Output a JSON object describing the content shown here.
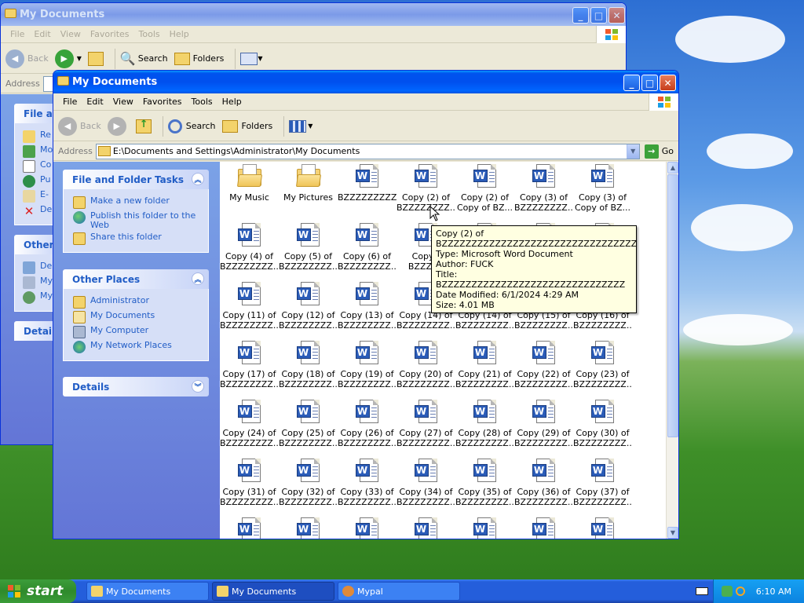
{
  "back_window": {
    "title": "My Documents",
    "menu": [
      "File",
      "Edit",
      "View",
      "Favorites",
      "Tools",
      "Help"
    ],
    "toolbar": {
      "back": "Back",
      "search": "Search",
      "folders": "Folders"
    },
    "address_label": "Address",
    "pane_headers": [
      "File an",
      "Other",
      "Details"
    ],
    "pane_items_a": [
      "Re",
      "Mo",
      "Co",
      "Pu",
      "E-",
      "De"
    ],
    "pane_items_b": [
      "De",
      "My",
      "My"
    ]
  },
  "front_window": {
    "title": "My Documents",
    "menu": [
      "File",
      "Edit",
      "View",
      "Favorites",
      "Tools",
      "Help"
    ],
    "toolbar": {
      "back": "Back",
      "search": "Search",
      "folders": "Folders"
    },
    "address": {
      "label": "Address",
      "value": "E:\\Documents and Settings\\Administrator\\My Documents",
      "go": "Go"
    },
    "tasks": {
      "title": "File and Folder Tasks",
      "items": [
        "Make a new folder",
        "Publish this folder to the Web",
        "Share this folder"
      ]
    },
    "other_places": {
      "title": "Other Places",
      "items": [
        "Administrator",
        "My Documents",
        "My Computer",
        "My Network Places"
      ]
    },
    "details": {
      "title": "Details"
    }
  },
  "files": [
    {
      "l1": "My Music",
      "l2": ""
    },
    {
      "l1": "My Pictures",
      "l2": ""
    },
    {
      "l1": "BZZZZZZZZZ...",
      "l2": ""
    },
    {
      "l1": "Copy (2) of",
      "l2": "BZZZZZZZZ..."
    },
    {
      "l1": "Copy (2) of",
      "l2": "Copy of BZ..."
    },
    {
      "l1": "Copy (3) of",
      "l2": "BZZZZZZZZ..."
    },
    {
      "l1": "Copy (3) of",
      "l2": "Copy of BZ..."
    },
    {
      "l1": "Copy (4) of",
      "l2": "BZZZZZZZZ..."
    },
    {
      "l1": "Copy (5) of",
      "l2": "BZZZZZZZZ..."
    },
    {
      "l1": "Copy (6) of",
      "l2": "BZZZZZZZZ..."
    },
    {
      "l1": "Copy (",
      "l2": "BZZZZZ"
    },
    {
      "l1": "",
      "l2": ""
    },
    {
      "l1": "",
      "l2": ""
    },
    {
      "l1": "",
      "l2": ""
    },
    {
      "l1": "Copy (11) of",
      "l2": "BZZZZZZZZ..."
    },
    {
      "l1": "Copy (12) of",
      "l2": "BZZZZZZZZ..."
    },
    {
      "l1": "Copy (13) of",
      "l2": "BZZZZZZZZ..."
    },
    {
      "l1": "Copy (14) of",
      "l2": "BZZZZZZZZ..."
    },
    {
      "l1": "Copy (14) of",
      "l2": "BZZZZZZZZ..."
    },
    {
      "l1": "Copy (15) of",
      "l2": "BZZZZZZZZ..."
    },
    {
      "l1": "Copy (16) of",
      "l2": "BZZZZZZZZ..."
    },
    {
      "l1": "Copy (17) of",
      "l2": "BZZZZZZZZ..."
    },
    {
      "l1": "Copy (18) of",
      "l2": "BZZZZZZZZ..."
    },
    {
      "l1": "Copy (19) of",
      "l2": "BZZZZZZZZ..."
    },
    {
      "l1": "Copy (20) of",
      "l2": "BZZZZZZZZ..."
    },
    {
      "l1": "Copy (21) of",
      "l2": "BZZZZZZZZ..."
    },
    {
      "l1": "Copy (22) of",
      "l2": "BZZZZZZZZ..."
    },
    {
      "l1": "Copy (23) of",
      "l2": "BZZZZZZZZ..."
    },
    {
      "l1": "Copy (24) of",
      "l2": "BZZZZZZZZ..."
    },
    {
      "l1": "Copy (25) of",
      "l2": "BZZZZZZZZ..."
    },
    {
      "l1": "Copy (26) of",
      "l2": "BZZZZZZZZ..."
    },
    {
      "l1": "Copy (27) of",
      "l2": "BZZZZZZZZ..."
    },
    {
      "l1": "Copy (28) of",
      "l2": "BZZZZZZZZ..."
    },
    {
      "l1": "Copy (29) of",
      "l2": "BZZZZZZZZ..."
    },
    {
      "l1": "Copy (30) of",
      "l2": "BZZZZZZZZ..."
    },
    {
      "l1": "Copy (31) of",
      "l2": "BZZZZZZZZ..."
    },
    {
      "l1": "Copy (32) of",
      "l2": "BZZZZZZZZ..."
    },
    {
      "l1": "Copy (33) of",
      "l2": "BZZZZZZZZ..."
    },
    {
      "l1": "Copy (34) of",
      "l2": "BZZZZZZZZ..."
    },
    {
      "l1": "Copy (35) of",
      "l2": "BZZZZZZZZ..."
    },
    {
      "l1": "Copy (36) of",
      "l2": "BZZZZZZZZ..."
    },
    {
      "l1": "Copy (37) of",
      "l2": "BZZZZZZZZ..."
    },
    {
      "l1": "",
      "l2": ""
    },
    {
      "l1": "",
      "l2": ""
    },
    {
      "l1": "",
      "l2": ""
    },
    {
      "l1": "",
      "l2": ""
    },
    {
      "l1": "",
      "l2": ""
    },
    {
      "l1": "",
      "l2": ""
    },
    {
      "l1": "",
      "l2": ""
    }
  ],
  "tooltip": [
    "Copy (2) of BZZZZZZZZZZZZZZZZZZZZZZZZZZZZZZZZZ",
    "Type: Microsoft Word Document",
    "Author: FUCK",
    "Title: BZZZZZZZZZZZZZZZZZZZZZZZZZZZZZZZ",
    "Date Modified: 6/1/2024 4:29 AM",
    "Size: 4.01 MB"
  ],
  "taskbar": {
    "start": "start",
    "tasks": [
      "My Documents",
      "My Documents",
      "Mypal"
    ],
    "clock": "6:10 AM"
  }
}
